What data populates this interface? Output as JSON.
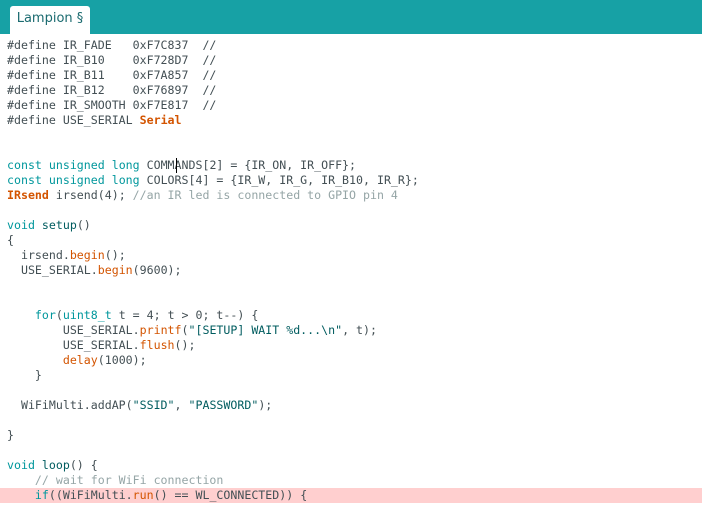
{
  "tab": {
    "label": "Lampion §"
  },
  "code": {
    "l0": [
      [
        "#define IR_FADE   0xF7C837  //",
        ""
      ]
    ],
    "l1": [
      [
        "#define IR_B10    0xF728D7  //",
        ""
      ]
    ],
    "l2": [
      [
        "#define IR_B11    0xF7A857  //",
        ""
      ]
    ],
    "l3": [
      [
        "#define IR_B12    0xF76897  //",
        ""
      ]
    ],
    "l4": [
      [
        "#define IR_SMOOTH 0xF7E817  //",
        ""
      ]
    ],
    "l5": [
      [
        "#define USE_SERIAL ",
        ""
      ],
      [
        "Serial",
        "bold"
      ]
    ],
    "l6": [],
    "l7": [],
    "l8": [
      [
        "const",
        "kw"
      ],
      [
        " ",
        ""
      ],
      [
        "unsigned",
        "kw"
      ],
      [
        " ",
        ""
      ],
      [
        "long",
        "kw"
      ],
      [
        " COMMANDS[2] = {IR_ON, IR_OFF};",
        ""
      ]
    ],
    "l9": [
      [
        "const",
        "kw"
      ],
      [
        " ",
        ""
      ],
      [
        "unsigned",
        "kw"
      ],
      [
        " ",
        ""
      ],
      [
        "long",
        "kw"
      ],
      [
        " COLORS[4] = {IR_W, IR_G, IR_B10, IR_R};",
        ""
      ]
    ],
    "l10": [
      [
        "IRsend",
        "bold"
      ],
      [
        " irsend(4); ",
        ""
      ],
      [
        "//an IR led is connected to GPIO pin 4",
        "cm"
      ]
    ],
    "l11": [],
    "l12": [
      [
        "void",
        "kw"
      ],
      [
        " ",
        ""
      ],
      [
        "setup",
        "lit"
      ],
      [
        "()",
        ""
      ]
    ],
    "l13": [
      [
        "{",
        ""
      ]
    ],
    "l14": [
      [
        "  irsend.",
        ""
      ],
      [
        "begin",
        "fn"
      ],
      [
        "();",
        ""
      ]
    ],
    "l15": [
      [
        "  USE_SERIAL.",
        ""
      ],
      [
        "begin",
        "fn"
      ],
      [
        "(9600);",
        ""
      ]
    ],
    "l16": [],
    "l17": [],
    "l18": [
      [
        "    ",
        ""
      ],
      [
        "for",
        "kw"
      ],
      [
        "(",
        ""
      ],
      [
        "uint8_t",
        "kw"
      ],
      [
        " t = 4; t > 0; t--) {",
        ""
      ]
    ],
    "l19": [
      [
        "        USE_SERIAL.",
        ""
      ],
      [
        "printf",
        "fn"
      ],
      [
        "(",
        ""
      ],
      [
        "\"[SETUP] WAIT %d...\\n\"",
        "lit"
      ],
      [
        ", t);",
        ""
      ]
    ],
    "l20": [
      [
        "        USE_SERIAL.",
        ""
      ],
      [
        "flush",
        "fn"
      ],
      [
        "();",
        ""
      ]
    ],
    "l21": [
      [
        "        ",
        ""
      ],
      [
        "delay",
        "fn"
      ],
      [
        "(1000);",
        ""
      ]
    ],
    "l22": [
      [
        "    }",
        ""
      ]
    ],
    "l23": [],
    "l24": [
      [
        "  WiFiMulti.addAP(",
        ""
      ],
      [
        "\"SSID\"",
        "lit"
      ],
      [
        ", ",
        ""
      ],
      [
        "\"PASSWORD\"",
        "lit"
      ],
      [
        ");",
        ""
      ]
    ],
    "l25": [],
    "l26": [
      [
        "}",
        ""
      ]
    ],
    "l27": [],
    "l28": [
      [
        "void",
        "kw"
      ],
      [
        " ",
        ""
      ],
      [
        "loop",
        "lit"
      ],
      [
        "() {",
        ""
      ]
    ],
    "l29": [
      [
        "    ",
        ""
      ],
      [
        "// wait for WiFi connection",
        "cm"
      ]
    ],
    "l30": [
      [
        "    ",
        ""
      ],
      [
        "if",
        "kw"
      ],
      [
        "((WiFiMulti.",
        ""
      ],
      [
        "run",
        "fn"
      ],
      [
        "() == WL_CONNECTED)) {",
        ""
      ]
    ]
  },
  "highlighted_line": 30
}
